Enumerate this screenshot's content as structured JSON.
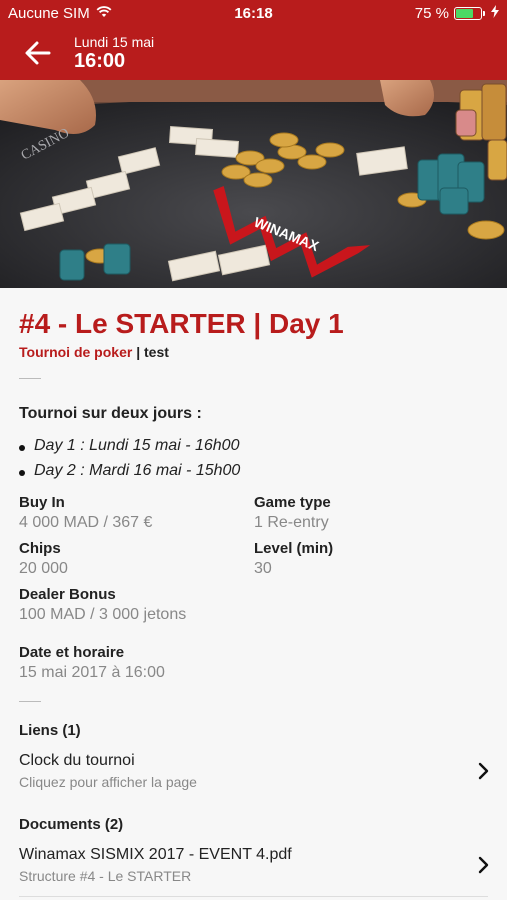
{
  "status_bar": {
    "carrier": "Aucune SIM",
    "time": "16:18",
    "battery_text": "75 %",
    "battery_level": 0.75,
    "icons": [
      "wifi-icon",
      "battery-icon",
      "charging-icon"
    ]
  },
  "nav": {
    "date": "Lundi 15 mai",
    "time": "16:00",
    "back_icon": "arrow-left-icon"
  },
  "hero": {
    "table_brand": "WINAMAX",
    "casino_text": "CASINO"
  },
  "event": {
    "title": "#4 - Le STARTER | Day 1",
    "category": "Tournoi de poker",
    "separator": "|",
    "tag": "test"
  },
  "description": {
    "heading": "Tournoi sur deux jours :",
    "bullets": [
      "Day 1 : Lundi 15 mai - 16h00",
      "Day 2 : Mardi 16 mai - 15h00"
    ]
  },
  "details": {
    "buy_in_label": "Buy In",
    "buy_in_value": "4 000 MAD / 367 €",
    "game_type_label": "Game type",
    "game_type_value": "1 Re-entry",
    "chips_label": "Chips",
    "chips_value": "20 000",
    "level_label": "Level (min)",
    "level_value": "30",
    "dealer_bonus_label": "Dealer Bonus",
    "dealer_bonus_value": "100 MAD / 3 000 jetons",
    "date_label": "Date et horaire",
    "date_value": "15 mai 2017 à 16:00"
  },
  "links": {
    "heading": "Liens (1)",
    "items": [
      {
        "title": "Clock du tournoi",
        "subtitle": "Cliquez pour afficher la page"
      }
    ]
  },
  "documents": {
    "heading": "Documents (2)",
    "items": [
      {
        "title": "Winamax SISMIX 2017 - EVENT 4.pdf",
        "subtitle": "Structure #4 - Le STARTER"
      }
    ]
  },
  "colors": {
    "brand_red": "#b81c1c",
    "muted_text": "#888888",
    "background": "#f7f7f7"
  }
}
